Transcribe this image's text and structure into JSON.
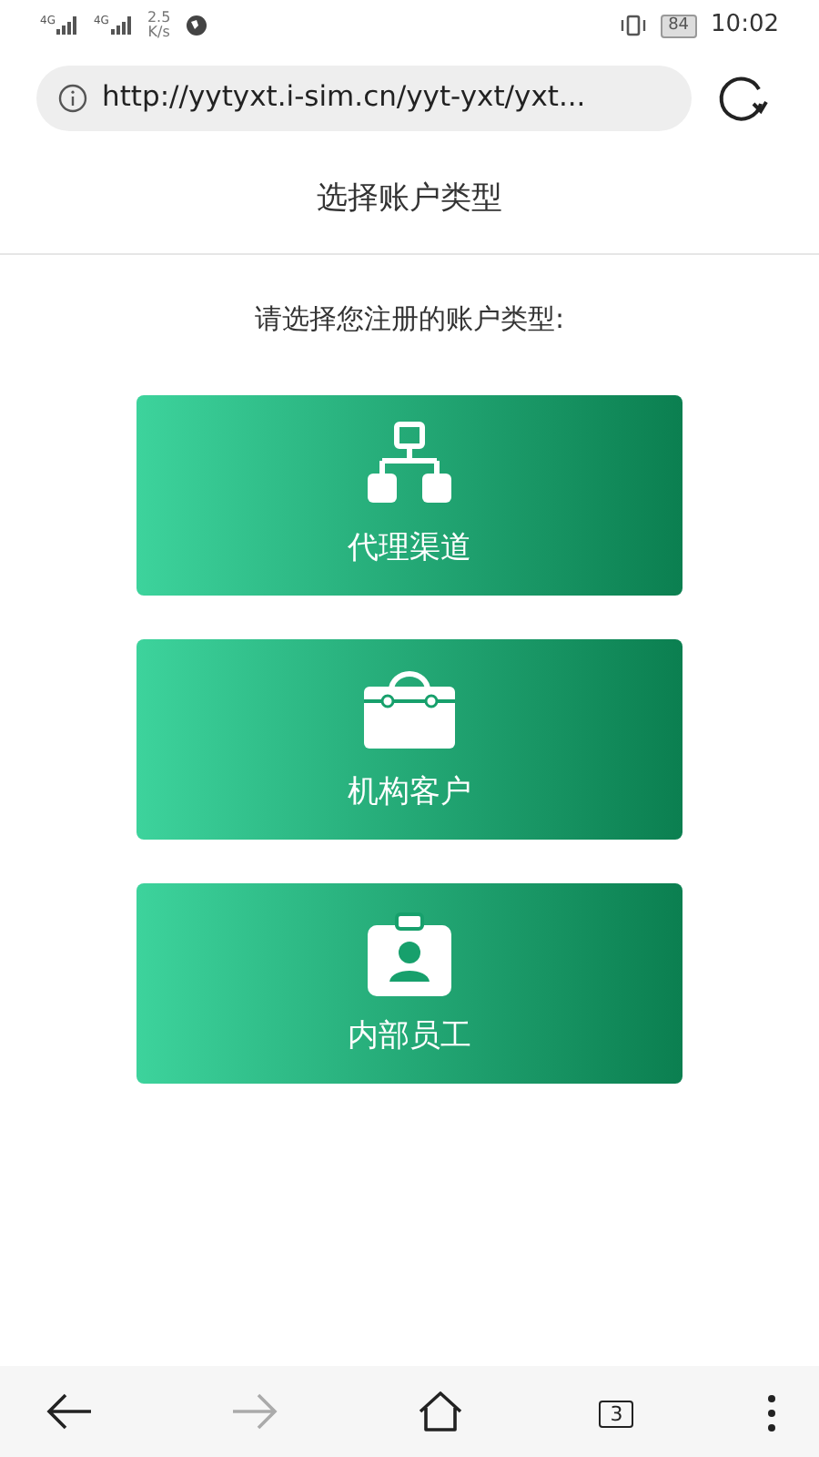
{
  "status_bar": {
    "signals": [
      "4G",
      "4G"
    ],
    "speed_value": "2.5",
    "speed_unit": "K/s",
    "battery": "84",
    "time": "10:02"
  },
  "address_bar": {
    "url": "http://yytyxt.i-sim.cn/yyt-yxt/yxt..."
  },
  "header": {
    "title": "选择账户类型"
  },
  "prompt": "请选择您注册的账户类型:",
  "account_types": [
    {
      "kind": "network",
      "label": "代理渠道"
    },
    {
      "kind": "toolbox",
      "label": "机构客户"
    },
    {
      "kind": "badge",
      "label": "内部员工"
    }
  ],
  "bottom_bar": {
    "back_disabled": false,
    "forward_disabled": true,
    "tab_count": "3"
  }
}
